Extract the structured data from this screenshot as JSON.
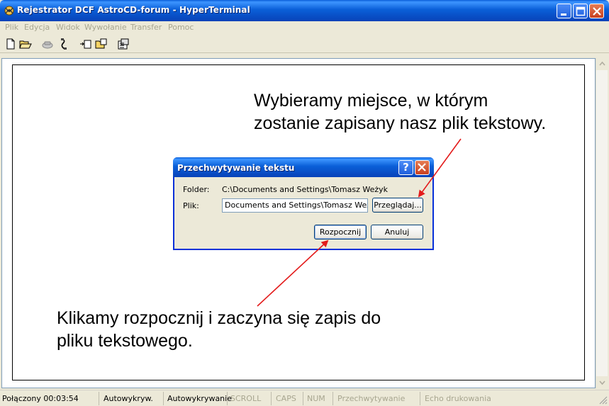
{
  "window": {
    "title": "Rejestrator DCF AstroCD-forum - HyperTerminal"
  },
  "menu": [
    "Plik",
    "Edycja",
    "Widok",
    "Wywołanie",
    "Transfer",
    "Pomoc"
  ],
  "toolbar": {
    "icons": [
      "new-file-icon",
      "open-folder-icon",
      "dial-icon",
      "disconnect-icon",
      "send-icon",
      "receive-icon",
      "properties-icon"
    ]
  },
  "annotations": {
    "top_line1": "Wybieramy miejsce, w którym",
    "top_line2": "zostanie zapisany nasz plik tekstowy.",
    "bottom_line1": "Klikamy rozpocznij i zaczyna się zapis do",
    "bottom_line2": "pliku tekstowego."
  },
  "dialog": {
    "title": "Przechwytywanie tekstu",
    "help_label": "?",
    "folder_label": "Folder:",
    "folder_value": "C:\\Documents and Settings\\Tomasz Weżyk",
    "file_label": "Plik:",
    "file_value": "Documents and Settings\\Tomasz Weżyk\\",
    "browse_label": "Przeglądaj...",
    "start_label": "Rozpocznij",
    "cancel_label": "Anuluj"
  },
  "status": {
    "connected": "Połączony 00:03:54",
    "detect1": "Autowykryw.",
    "detect2": "Autowykrywanie",
    "scroll": "SCROLL",
    "caps": "CAPS",
    "num": "NUM",
    "capture": "Przechwytywanie",
    "echo": "Echo drukowania"
  },
  "colors": {
    "titlebar": "#0a5fd8",
    "arrow": "#e31b1b",
    "face": "#ece9d8"
  }
}
